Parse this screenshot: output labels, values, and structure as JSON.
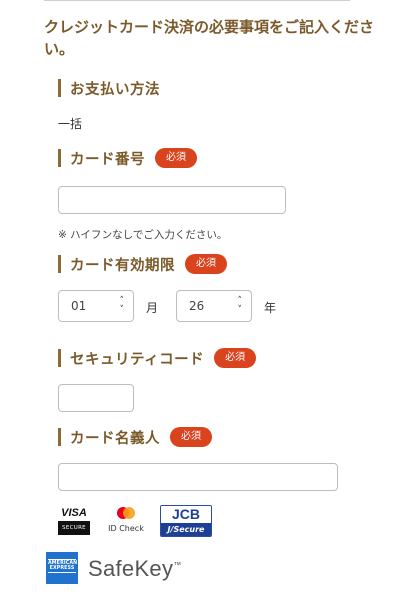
{
  "header": {
    "title": "クレジットカード決済の必要事項をご記入ください。"
  },
  "payment_method": {
    "label": "お支払い方法",
    "value": "一括"
  },
  "card_number": {
    "label": "カード番号",
    "required": "必須",
    "value": "",
    "note": "※ ハイフンなしでご入力ください。"
  },
  "expiry": {
    "label": "カード有効期限",
    "required": "必須",
    "month": "01",
    "month_unit": "月",
    "year": "26",
    "year_unit": "年"
  },
  "security_code": {
    "label": "セキュリティコード",
    "required": "必須",
    "value": ""
  },
  "card_name": {
    "label": "カード名義人",
    "required": "必須",
    "value": ""
  },
  "badges": {
    "visa_top": "VISA",
    "visa_bottom": "SECURE",
    "mc_text": "ID Check",
    "jcb_top": "JCB",
    "jcb_bottom": "J/Secure",
    "amex_top": "AMERICAN",
    "amex_bottom": "EXPRESS",
    "safekey": "SafeKey",
    "safekey_tm": "™"
  },
  "colors": {
    "heading": "#7a5a2a",
    "accent_bar": "#8a6a36",
    "required_badge": "#d9431e"
  }
}
